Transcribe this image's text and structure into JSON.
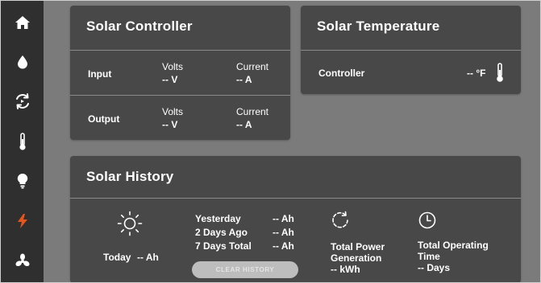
{
  "sidebar": {
    "items": [
      {
        "icon": "home-icon",
        "active": false
      },
      {
        "icon": "water-drop-icon",
        "active": false
      },
      {
        "icon": "rotate-sync-icon",
        "active": false
      },
      {
        "icon": "thermometer-icon",
        "active": false
      },
      {
        "icon": "light-bulb-icon",
        "active": false
      },
      {
        "icon": "lightning-bolt-icon",
        "active": true
      },
      {
        "icon": "fan-icon",
        "active": false
      }
    ],
    "active_color": "#e8551c"
  },
  "controller": {
    "title": "Solar Controller",
    "input": {
      "label": "Input",
      "volts_label": "Volts",
      "volts_value": "-- V",
      "current_label": "Current",
      "current_value": "-- A"
    },
    "output": {
      "label": "Output",
      "volts_label": "Volts",
      "volts_value": "-- V",
      "current_label": "Current",
      "current_value": "-- A"
    }
  },
  "temperature": {
    "title": "Solar Temperature",
    "controller_label": "Controller",
    "controller_value": "-- °F"
  },
  "history": {
    "title": "Solar History",
    "today_label": "Today",
    "today_value": "-- Ah",
    "yesterday_label": "Yesterday",
    "yesterday_value": "-- Ah",
    "two_days_label": "2 Days Ago",
    "two_days_value": "-- Ah",
    "seven_days_label": "7 Days Total",
    "seven_days_value": "-- Ah",
    "clear_button": "CLEAR HISTORY",
    "power_label_1": "Total Power",
    "power_label_2": "Generation",
    "power_value": "-- kWh",
    "time_label_1": "Total Operating",
    "time_label_2": "Time",
    "time_value": "-- Days"
  }
}
